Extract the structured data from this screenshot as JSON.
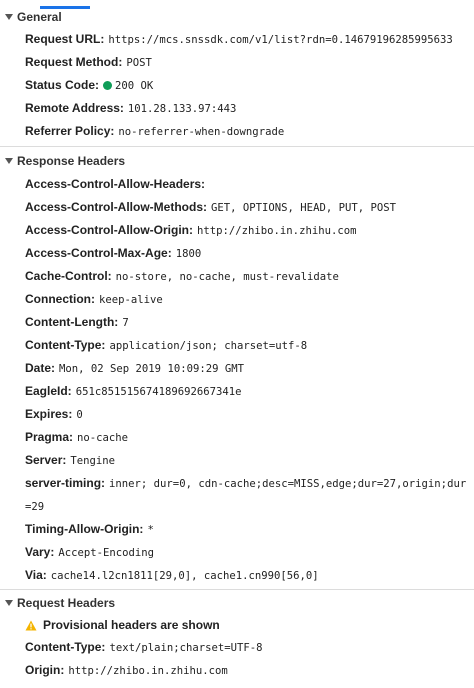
{
  "general": {
    "title": "General",
    "request_url_key": "Request URL:",
    "request_url_value": "https://mcs.snssdk.com/v1/list?rdn=0.14679196285995633",
    "request_method_key": "Request Method:",
    "request_method_value": "POST",
    "status_code_key": "Status Code:",
    "status_code_value": "200 OK",
    "remote_address_key": "Remote Address:",
    "remote_address_value": "101.28.133.97:443",
    "referrer_policy_key": "Referrer Policy:",
    "referrer_policy_value": "no-referrer-when-downgrade"
  },
  "response_headers": {
    "title": "Response Headers",
    "items": [
      {
        "key": "Access-Control-Allow-Headers:",
        "value": ""
      },
      {
        "key": "Access-Control-Allow-Methods:",
        "value": "GET, OPTIONS, HEAD, PUT, POST"
      },
      {
        "key": "Access-Control-Allow-Origin:",
        "value": "http://zhibo.in.zhihu.com"
      },
      {
        "key": "Access-Control-Max-Age:",
        "value": "1800"
      },
      {
        "key": "Cache-Control:",
        "value": "no-store, no-cache, must-revalidate"
      },
      {
        "key": "Connection:",
        "value": "keep-alive"
      },
      {
        "key": "Content-Length:",
        "value": "7"
      },
      {
        "key": "Content-Type:",
        "value": "application/json; charset=utf-8"
      },
      {
        "key": "Date:",
        "value": "Mon, 02 Sep 2019 10:09:29 GMT"
      },
      {
        "key": "EagleId:",
        "value": "651c851515674189692667341e"
      },
      {
        "key": "Expires:",
        "value": "0"
      },
      {
        "key": "Pragma:",
        "value": "no-cache"
      },
      {
        "key": "Server:",
        "value": "Tengine"
      },
      {
        "key": "server-timing:",
        "value": "inner; dur=0, cdn-cache;desc=MISS,edge;dur=27,origin;dur=29"
      },
      {
        "key": "Timing-Allow-Origin:",
        "value": "*"
      },
      {
        "key": "Vary:",
        "value": "Accept-Encoding"
      },
      {
        "key": "Via:",
        "value": "cache14.l2cn1811[29,0], cache1.cn990[56,0]"
      }
    ]
  },
  "request_headers": {
    "title": "Request Headers",
    "warning": "Provisional headers are shown",
    "items": [
      {
        "key": "Content-Type:",
        "value": "text/plain;charset=UTF-8"
      },
      {
        "key": "Origin:",
        "value": "http://zhibo.in.zhihu.com"
      }
    ]
  },
  "colors": {
    "status_ok": "#0f9d58",
    "warning": "#f4b400",
    "tab_accent": "#1a73e8"
  }
}
